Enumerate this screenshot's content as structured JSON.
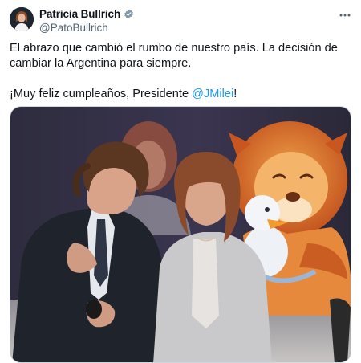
{
  "author": {
    "display_name": "Patricia Bullrich",
    "handle": "@PatoBullrich",
    "verified_icon": "verified-badge-icon"
  },
  "tweet": {
    "line1": "El abrazo que cambió el rumbo de nuestro país. La decisión de cambiar la Argentina para siempre.",
    "line2_prefix": "¡Muy feliz cumpleaños, Presidente ",
    "mention": "@JMilei",
    "line2_suffix": "!"
  },
  "media": {
    "alt": "Photo"
  },
  "colors": {
    "accent": "#1d9bf0",
    "text": "#0f1419",
    "secondary": "#536471"
  }
}
